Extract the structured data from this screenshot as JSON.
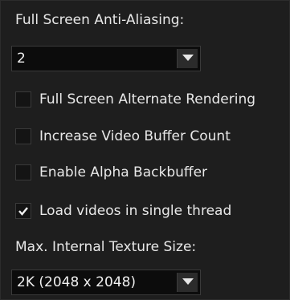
{
  "fsaa": {
    "label": "Full Screen Anti-Aliasing:",
    "value": "2"
  },
  "options": [
    {
      "label": "Full Screen Alternate Rendering",
      "checked": false
    },
    {
      "label": "Increase Video Buffer Count",
      "checked": false
    },
    {
      "label": "Enable Alpha Backbuffer",
      "checked": false
    },
    {
      "label": "Load videos in single thread",
      "checked": true
    }
  ],
  "texture": {
    "label": "Max. Internal Texture Size:",
    "value": "2K (2048 x 2048)"
  },
  "icons": {
    "dropdown": "chevron-down-icon",
    "check": "checkmark-icon"
  }
}
